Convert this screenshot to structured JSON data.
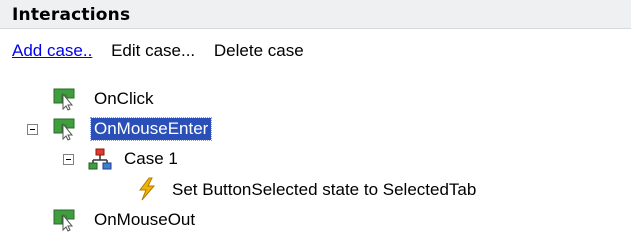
{
  "panel": {
    "title": "Interactions"
  },
  "actions": {
    "add_case": "Add case..",
    "edit_case": "Edit case...",
    "delete_case": "Delete case"
  },
  "tree": {
    "on_click": "OnClick",
    "on_mouse_enter": "OnMouseEnter",
    "case_1": "Case 1",
    "action_1": "Set ButtonSelected state to SelectedTab",
    "on_mouse_out": "OnMouseOut"
  },
  "colors": {
    "selection": "#2a4fb8",
    "link": "#0000ee",
    "event_icon_green": "#3f9f3f",
    "lightning": "#f2b400"
  },
  "icons": {
    "event": "cursor-event-icon",
    "case": "org-chart-case-icon",
    "action": "lightning-action-icon",
    "expander": "collapse-minus-icon"
  }
}
